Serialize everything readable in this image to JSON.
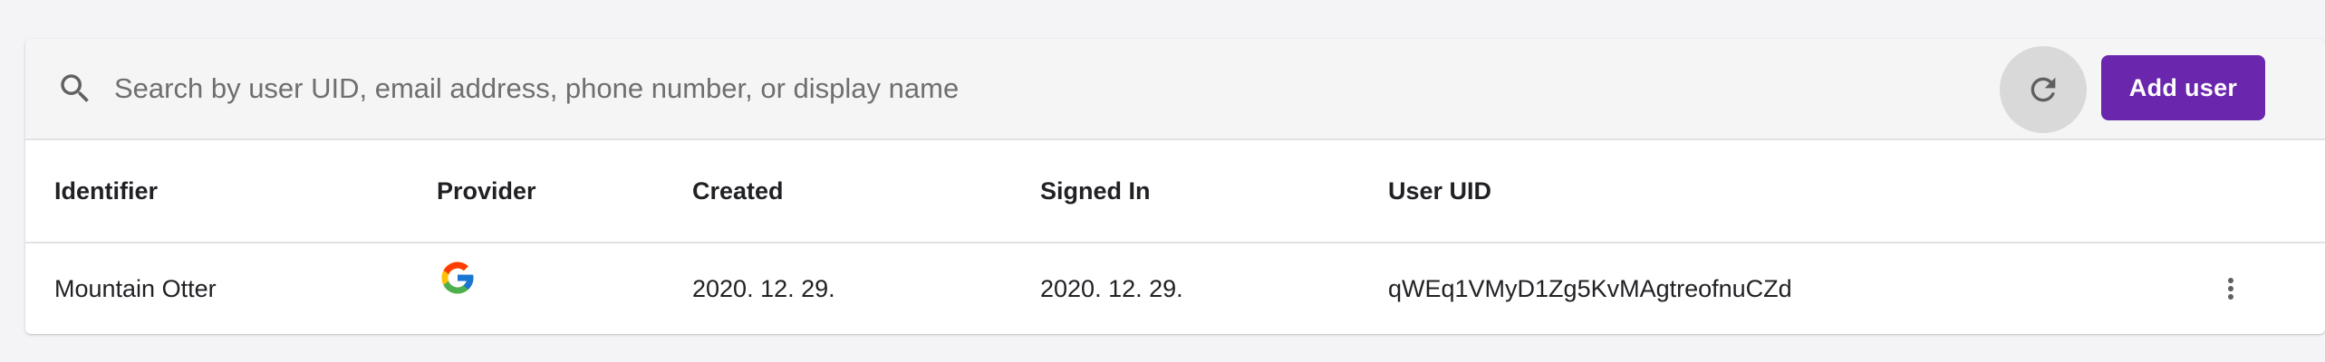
{
  "search": {
    "placeholder": "Search by user UID, email address, phone number, or display name",
    "value": "",
    "icon": "search-icon"
  },
  "toolbar": {
    "refresh_icon": "refresh-icon",
    "add_user_label": "Add user",
    "accent_color": "#6a26ad"
  },
  "table": {
    "columns": [
      "Identifier",
      "Provider",
      "Created",
      "Signed In",
      "User UID"
    ],
    "rows": [
      {
        "identifier": "Mountain Otter",
        "provider_icon": "google-icon",
        "created": "2020. 12. 29.",
        "signed_in": "2020. 12. 29.",
        "user_uid": "qWEq1VMyD1Zg5KvMAgtreofnuCZd",
        "actions_icon": "more-vert-icon"
      }
    ]
  }
}
